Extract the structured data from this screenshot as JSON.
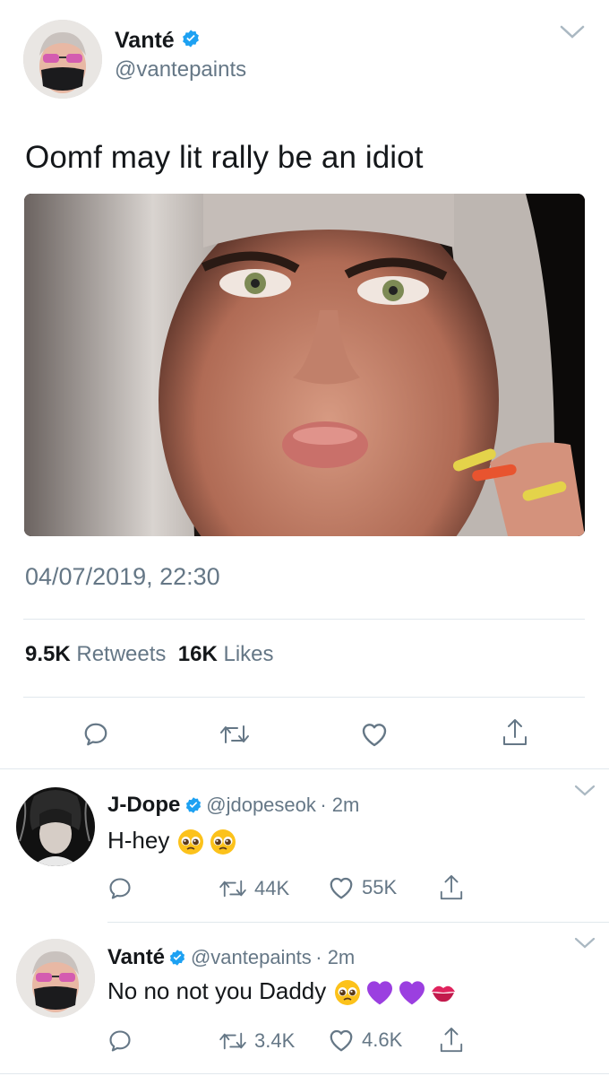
{
  "main_tweet": {
    "author_name": "Vanté",
    "author_handle": "@vantepaints",
    "text": "Oomf may lit rally be an idiot",
    "timestamp": "04/07/2019, 22:30",
    "retweets_count": "9.5K",
    "retweets_label": "Retweets",
    "likes_count": "16K",
    "likes_label": "Likes"
  },
  "replies": [
    {
      "author_name": "J-Dope",
      "author_handle": "@jdopeseok",
      "time": "· 2m",
      "text": "H-hey",
      "retweets": "44K",
      "likes": "55K"
    },
    {
      "author_name": "Vanté",
      "author_handle": "@vantepaints",
      "time": "· 2m",
      "text": "No no not you Daddy",
      "retweets": "3.4K",
      "likes": "4.6K"
    }
  ],
  "colors": {
    "twitter_blue": "#1da1f2",
    "secondary_text": "#657786",
    "divider": "#e1e8ed"
  },
  "icons": [
    "chevron-down-icon",
    "verified-badge-icon",
    "reply-icon",
    "retweet-icon",
    "like-icon",
    "share-icon",
    "pleading-face-emoji",
    "purple-heart-emoji",
    "kiss-mark-emoji"
  ]
}
